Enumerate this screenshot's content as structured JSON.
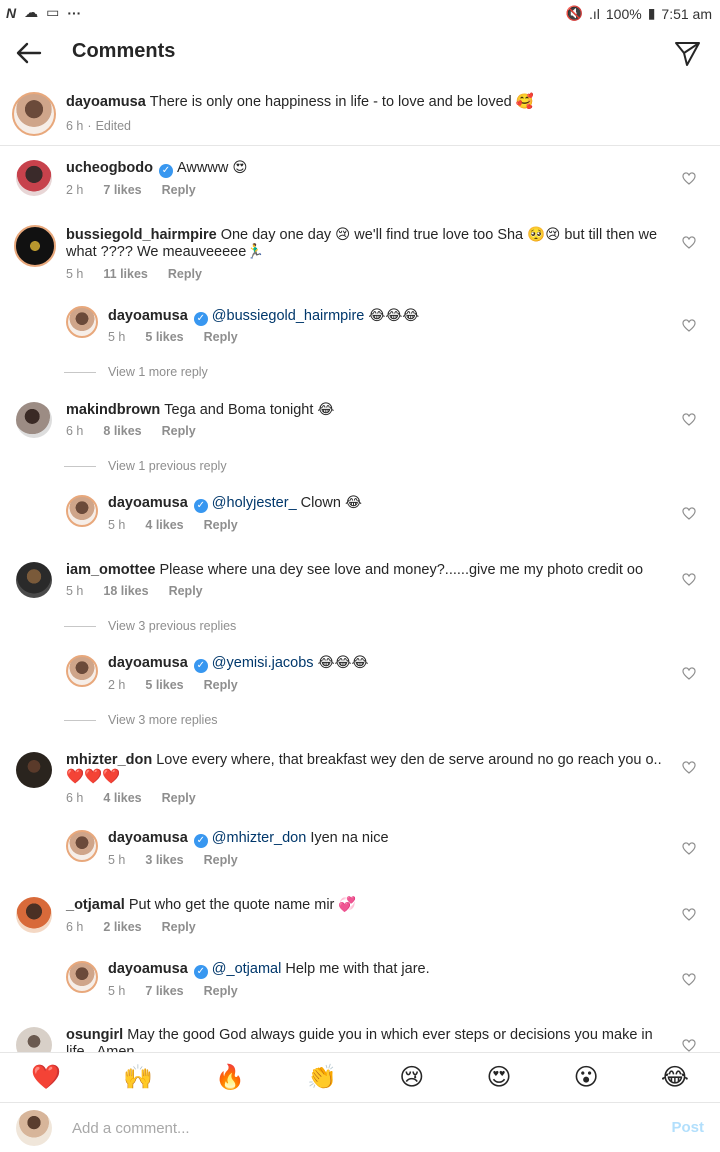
{
  "status_bar": {
    "battery": "100%",
    "time": "7:51 am"
  },
  "header": {
    "title": "Comments"
  },
  "caption": {
    "user": "dayoamusa",
    "text": "There is only one happiness in life - to love and be loved 🥰",
    "time": "6 h",
    "edited": "Edited"
  },
  "comments": [
    {
      "user": "ucheogbodo",
      "verified": true,
      "text": "Awwww 😍",
      "time": "2 h",
      "likes": "7 likes",
      "reply": "Reply"
    },
    {
      "user": "bussiegold_hairmpire",
      "text": "One day one day 😢 we'll find true love too Sha 🥺😢 but till then we what ???? We meauveeeee🏃‍♂️",
      "time": "5 h",
      "likes": "11 likes",
      "reply": "Reply"
    },
    {
      "user": "dayoamusa",
      "verified": true,
      "mention": "@bussiegold_hairmpire",
      "text": "😂😂😂",
      "time": "5 h",
      "likes": "5 likes",
      "reply": "Reply"
    },
    {
      "view": "View 1 more reply"
    },
    {
      "user": "makindbrown",
      "text": "Tega and Boma tonight 😂",
      "time": "6 h",
      "likes": "8 likes",
      "reply": "Reply"
    },
    {
      "view": "View 1 previous reply"
    },
    {
      "user": "dayoamusa",
      "verified": true,
      "mention": "@holyjester_",
      "text": "Clown 😂",
      "time": "5 h",
      "likes": "4 likes",
      "reply": "Reply"
    },
    {
      "user": "iam_omottee",
      "text": "Please where una dey see love and money?......give me my photo credit oo",
      "time": "5 h",
      "likes": "18 likes",
      "reply": "Reply"
    },
    {
      "view": "View 3 previous replies"
    },
    {
      "user": "dayoamusa",
      "verified": true,
      "mention": "@yemisi.jacobs",
      "text": "😂😂😂",
      "time": "2 h",
      "likes": "5 likes",
      "reply": "Reply"
    },
    {
      "view": "View 3 more replies"
    },
    {
      "user": "mhizter_don",
      "text": "Love every where, that breakfast wey den de serve around no go reach you o.. ❤️❤️❤️",
      "time": "6 h",
      "likes": "4 likes",
      "reply": "Reply"
    },
    {
      "user": "dayoamusa",
      "verified": true,
      "mention": "@mhizter_don",
      "text": "Iyen na nice",
      "time": "5 h",
      "likes": "3 likes",
      "reply": "Reply"
    },
    {
      "user": "_otjamal",
      "text": "Put who get the quote name mir 💞",
      "time": "6 h",
      "likes": "2 likes",
      "reply": "Reply"
    },
    {
      "user": "dayoamusa",
      "verified": true,
      "mention": "@_otjamal",
      "text": "Help me with that jare.",
      "time": "5 h",
      "likes": "7 likes",
      "reply": "Reply"
    },
    {
      "user": "osungirl",
      "text": "May the good  God always guide you in which ever steps or decisions you make in life...Amen"
    }
  ],
  "emoji_bar": [
    "❤️",
    "🙌",
    "🔥",
    "👏",
    "😢",
    "😍",
    "😮",
    "😂"
  ],
  "input": {
    "placeholder": "Add a comment...",
    "post": "Post"
  },
  "colors": {
    "link": "#00376b",
    "post": "#b2dffc",
    "verified": "#3897f0"
  }
}
